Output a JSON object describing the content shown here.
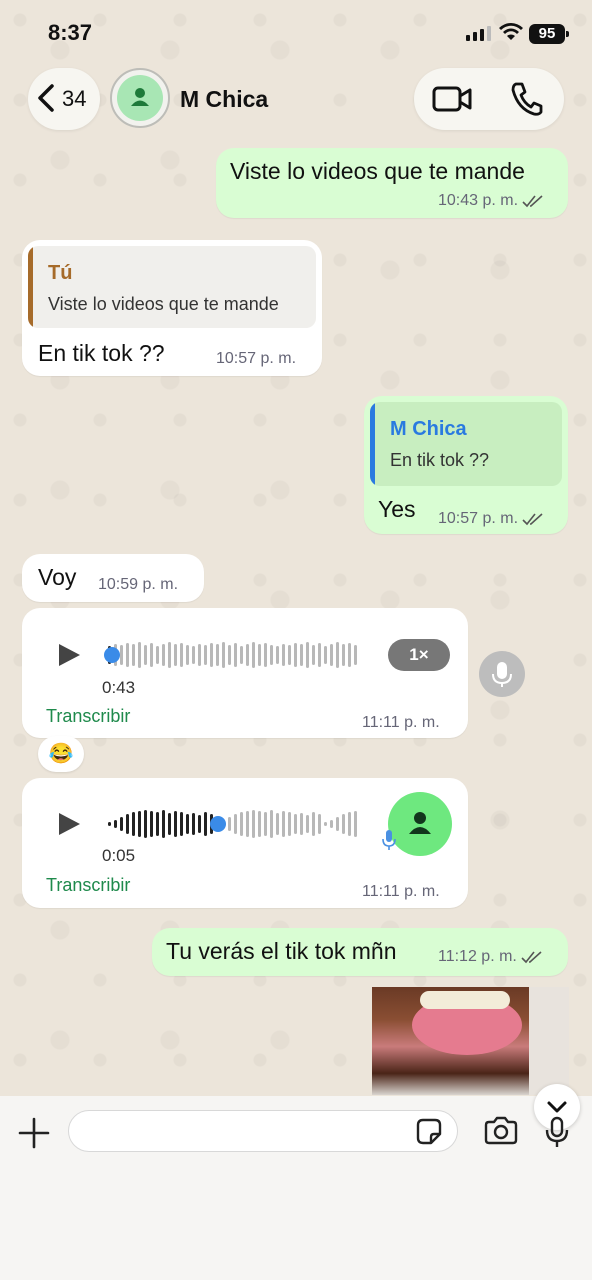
{
  "status": {
    "time": "8:37",
    "battery": "95"
  },
  "header": {
    "back_count": "34",
    "contact_name": "M Chica"
  },
  "messages": [
    {
      "text": "Viste lo videos que te mande",
      "time": "10:43 p. m."
    },
    {
      "quote_author": "Tú",
      "quote_text": "Viste lo videos que te mande",
      "text": "En tik tok ??",
      "time": "10:57 p. m."
    },
    {
      "quote_author": "M Chica",
      "quote_text": "En tik tok ??",
      "text": "Yes",
      "time": "10:57 p. m."
    },
    {
      "text": "Voy",
      "time": "10:59 p. m."
    },
    {
      "duration": "0:43",
      "speed": "1×",
      "transcribe": "Transcribir",
      "time": "11:11 p. m.",
      "reaction": "😂",
      "progress": 0.02
    },
    {
      "duration": "0:05",
      "transcribe": "Transcribir",
      "time": "11:11 p. m.",
      "progress": 0.42
    },
    {
      "text": "Tu verás el tik tok mñn",
      "time": "11:12 p. m."
    }
  ],
  "input": {
    "placeholder": ""
  },
  "colors": {
    "outgoing": "#d9fdd3",
    "incoming": "#ffffff",
    "accent": "#1f8a4c"
  }
}
